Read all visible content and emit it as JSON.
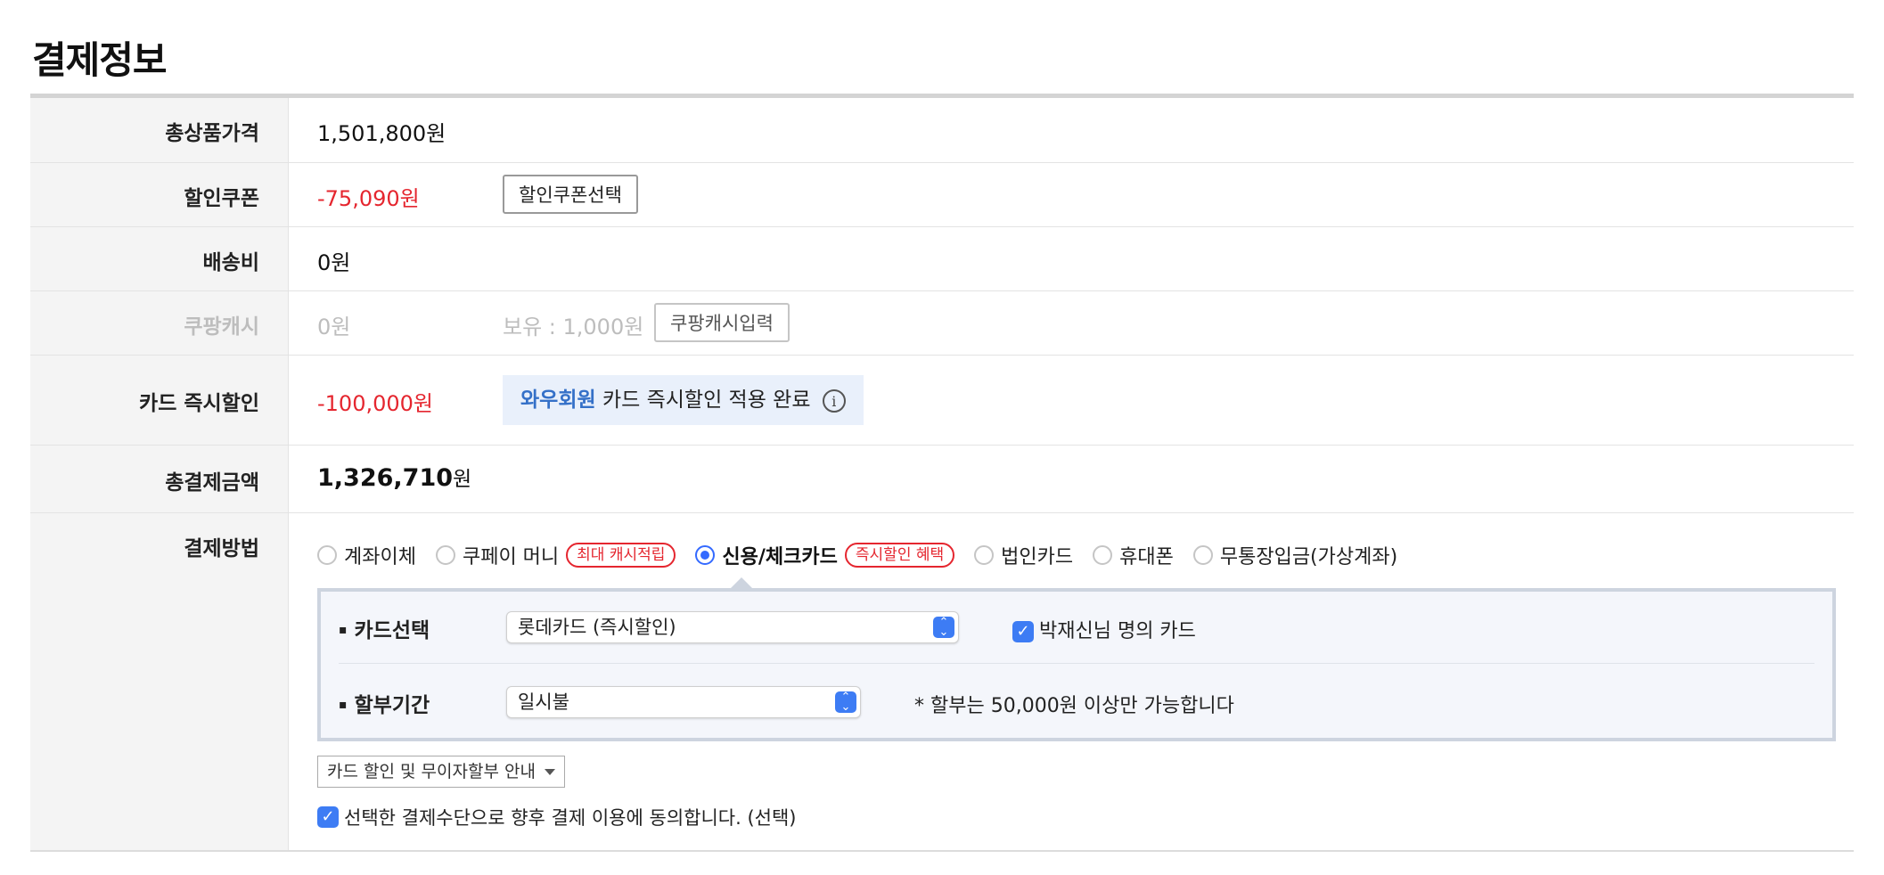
{
  "page_title": "결제정보",
  "rows": {
    "total_price": {
      "label": "총상품가격",
      "value": "1,501,800원"
    },
    "coupon": {
      "label": "할인쿠폰",
      "value": "-75,090원",
      "button": "할인쿠폰선택"
    },
    "shipping": {
      "label": "배송비",
      "value": "0원"
    },
    "coupang_cash": {
      "label": "쿠팡캐시",
      "value": "0원",
      "holding": "보유 : 1,000원",
      "button": "쿠팡캐시입력"
    },
    "card_discount": {
      "label": "카드 즉시할인",
      "value": "-100,000원",
      "notice_highlight": "와우회원",
      "notice_text": " 카드 즉시할인 적용 완료",
      "info_icon": "i"
    },
    "total_payment": {
      "label": "총결제금액",
      "value": "1,326,710",
      "unit": "원"
    },
    "payment_method": {
      "label": "결제방법",
      "options": [
        {
          "label": "계좌이체",
          "selected": false
        },
        {
          "label": "쿠페이 머니",
          "selected": false,
          "badge": "최대 캐시적립"
        },
        {
          "label": "신용/체크카드",
          "selected": true,
          "badge": "즉시할인 혜택"
        },
        {
          "label": "법인카드",
          "selected": false
        },
        {
          "label": "휴대폰",
          "selected": false
        },
        {
          "label": "무통장입금(가상계좌)",
          "selected": false
        }
      ],
      "card_select_label": "카드선택",
      "card_select_value": "롯데카드 (즉시할인)",
      "card_owner_checkbox": "박재신님 명의 카드",
      "installment_label": "할부기간",
      "installment_value": "일시불",
      "installment_note": "* 할부는 50,000원 이상만 가능합니다",
      "guide_dropdown": "카드 할인 및 무이자할부 안내",
      "agree_text": "선택한 결제수단으로 향후 결제 이용에 동의합니다. (선택)"
    }
  },
  "colors": {
    "accent_blue": "#346aff",
    "discount_red": "#e5262f",
    "notice_bg": "#e9f0fb"
  }
}
